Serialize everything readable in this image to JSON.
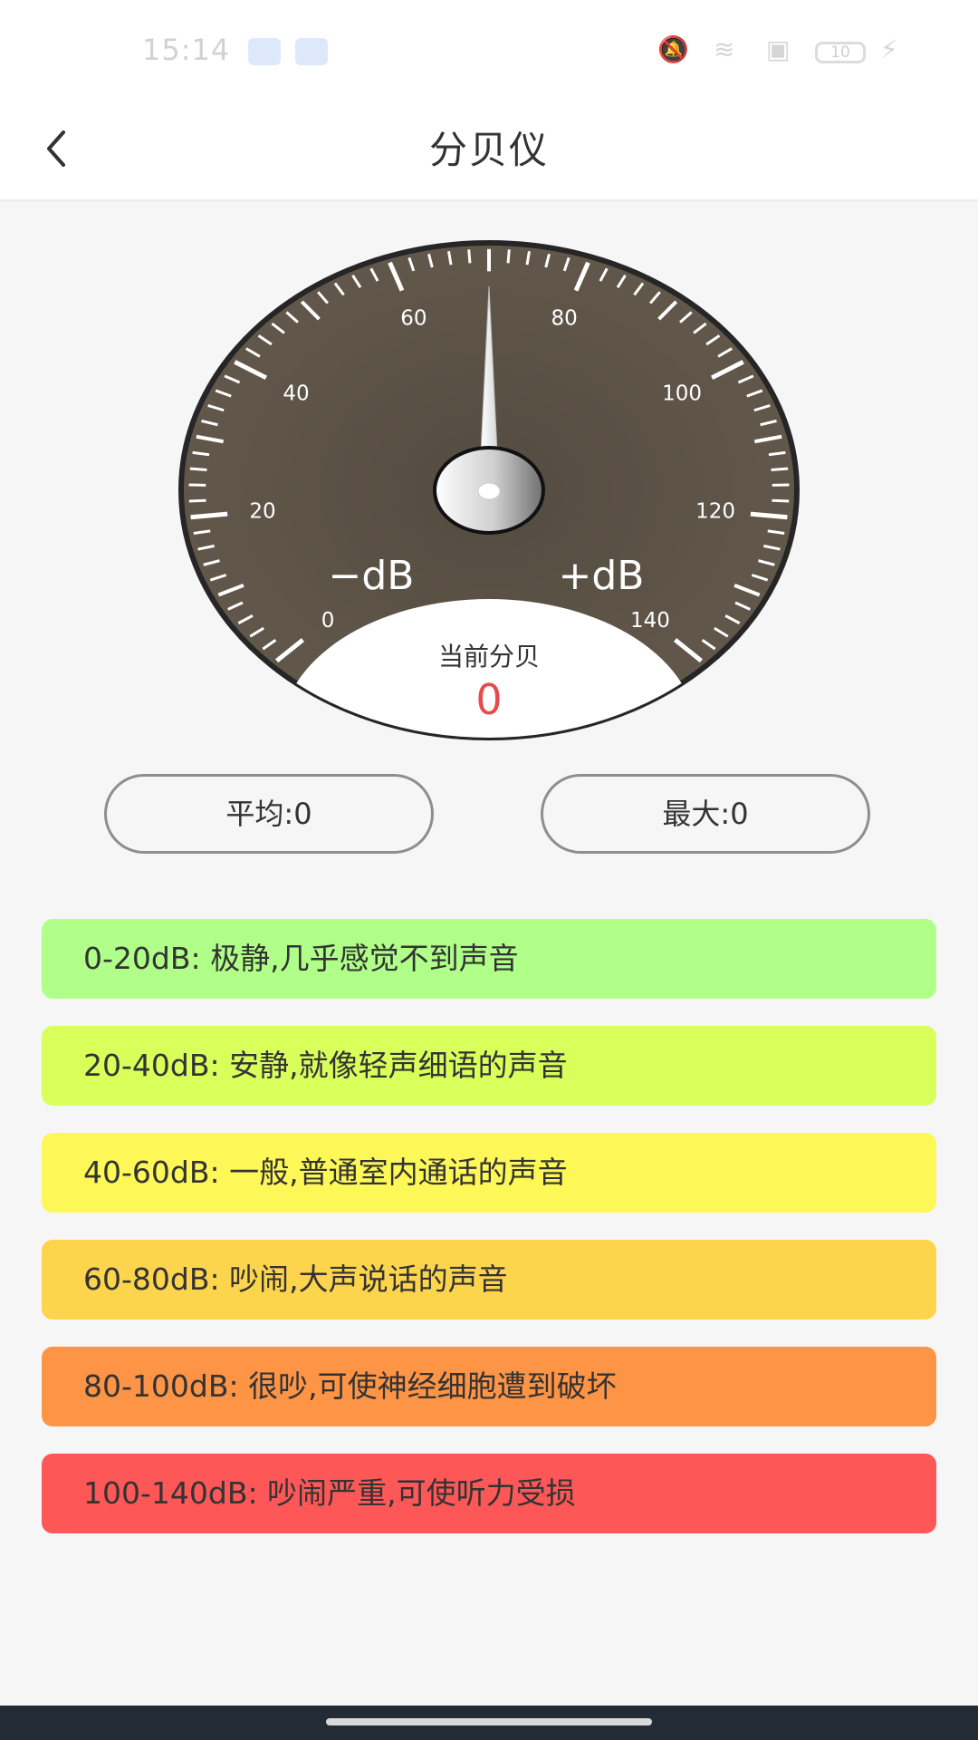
{
  "status_bar": {
    "time": "15:14",
    "battery": "10"
  },
  "header": {
    "title": "分贝仪"
  },
  "gauge": {
    "tick_labels": [
      "0",
      "20",
      "40",
      "60",
      "80",
      "100",
      "120",
      "140"
    ],
    "minus_label": "−dB",
    "plus_label": "+dB",
    "current_label": "当前分贝",
    "current_value": "0",
    "min_db": 0,
    "max_db": 140,
    "needle_db": 70,
    "colors": {
      "face": "#5e5549",
      "value": "#e74c4c"
    }
  },
  "stats": {
    "average": "平均:0",
    "max": "最大:0"
  },
  "levels": [
    {
      "text": "0-20dB: 极静,几乎感觉不到声音",
      "color": "#b0ff88"
    },
    {
      "text": "20-40dB: 安静,就像轻声细语的声音",
      "color": "#d8ff5a"
    },
    {
      "text": "40-60dB: 一般,普通室内通话的声音",
      "color": "#fdf857"
    },
    {
      "text": "60-80dB: 吵闹,大声说话的声音",
      "color": "#fdd54c"
    },
    {
      "text": "80-100dB: 很吵,可使神经细胞遭到破坏",
      "color": "#fe9446"
    },
    {
      "text": "100-140dB: 吵闹严重,可使听力受损",
      "color": "#fe5757"
    }
  ]
}
